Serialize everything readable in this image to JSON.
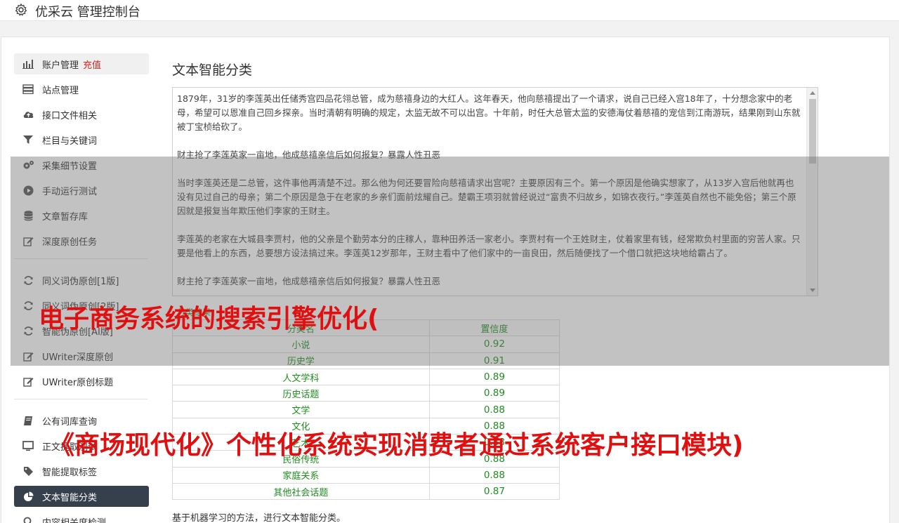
{
  "header": {
    "title": "优采云 管理控制台"
  },
  "sidebar": {
    "group1": [
      {
        "label": "账户管理",
        "badge": "充值",
        "icon": "bar-chart-icon"
      },
      {
        "label": "站点管理",
        "icon": "server-icon"
      },
      {
        "label": "接口文件相关",
        "icon": "cloud-upload-icon"
      },
      {
        "label": "栏目与关键词",
        "icon": "filter-icon"
      },
      {
        "label": "采集细节设置",
        "icon": "gears-icon"
      },
      {
        "label": "手动运行测试",
        "icon": "play-circle-icon"
      },
      {
        "label": "文章暂存库",
        "icon": "database-icon"
      },
      {
        "label": "深度原创任务",
        "icon": "edit-icon"
      }
    ],
    "group2": [
      {
        "label": "同义词伪原创[1版]",
        "icon": "refresh-icon"
      },
      {
        "label": "同义词伪原创[2版]",
        "icon": "refresh-icon"
      },
      {
        "label": "智能伪原创[AI版]",
        "icon": "refresh-icon"
      },
      {
        "label": "UWriter深度原创",
        "icon": "edit-icon"
      },
      {
        "label": "UWriter原创标题",
        "icon": "edit-icon"
      }
    ],
    "group3": [
      {
        "label": "公有词库查询",
        "icon": "book-icon"
      },
      {
        "label": "正文提取测试",
        "icon": "monitor-icon"
      },
      {
        "label": "智能提取标签",
        "icon": "tag-icon"
      },
      {
        "label": "文本智能分类",
        "icon": "pie-chart-icon"
      },
      {
        "label": "内容相关度检测",
        "icon": "search-icon"
      }
    ]
  },
  "main": {
    "title": "文本智能分类",
    "text_value": "1879年，31岁的李莲英出任储秀宫四品花翎总管，成为慈禧身边的大红人。这年春天，他向慈禧提出了一个请求，说自己已经入宫18年了，十分想念家中的老母，希望可以恩准自己回乡探亲。当时清朝有明确的规定，太监无故不可以出宫。十年前，时任大总管太监的安德海仗着慈禧的宠信到江南游玩，结果刚到山东就被丁宝桢给砍了。\n\n财主抢了李莲英家一亩地，他成慈禧亲信后如何报复？暴露人性丑恶\n\n当时李莲英还是二总管，这件事他再清楚不过。那么他为何还要冒险向慈禧请求出宫呢？主要原因有三个。第一个原因是他确实想家了，从13岁入宫后他就再也没有见过自己的母亲；第二个原因是急于在老家的乡亲们面前炫耀自己。楚霸王项羽就曾经说过“富贵不归故乡，如锦衣夜行。”李莲英自然也不能免俗；第三个原因就是报复当年欺压他们李家的王财主。\n\n李莲英的老家在大城县李贾村，他的父亲是个勤劳本分的庄稼人，靠种田养活一家老小。李贾村有一个王姓财主，仗着家里有钱，经常欺负村里面的穷苦人家。只要是他看上的东西，总要想方设法搞过来。李莲英12岁那年，王财主看中了他们家中的一亩良田，然后随便找了一个借口就把这块地给霸占了。\n\n财主抢了李莲英家一亩地，他成慈禧亲信后如何报复？暴露人性丑恶",
    "results_label": "分类结果",
    "table": {
      "headers": [
        "分类名",
        "置信度"
      ],
      "rows": [
        [
          "小说",
          "0.92"
        ],
        [
          "历史学",
          "0.91"
        ],
        [
          "人文学科",
          "0.89"
        ],
        [
          "历史话题",
          "0.89"
        ],
        [
          "文学",
          "0.88"
        ],
        [
          "文化",
          "0.88"
        ],
        [
          "艺术",
          "0.88"
        ],
        [
          "民俗传统",
          "0.88"
        ],
        [
          "家庭关系",
          "0.88"
        ],
        [
          "其他社会话题",
          "0.87"
        ]
      ]
    },
    "footer_note": "基于机器学习的方法，进行文本智能分类。"
  },
  "overlay": {
    "line1": "电子商务系统的搜索引擎优化(",
    "line2": "《商场现代化》个性化系统实现消费者通过系统客户接口模块)"
  }
}
